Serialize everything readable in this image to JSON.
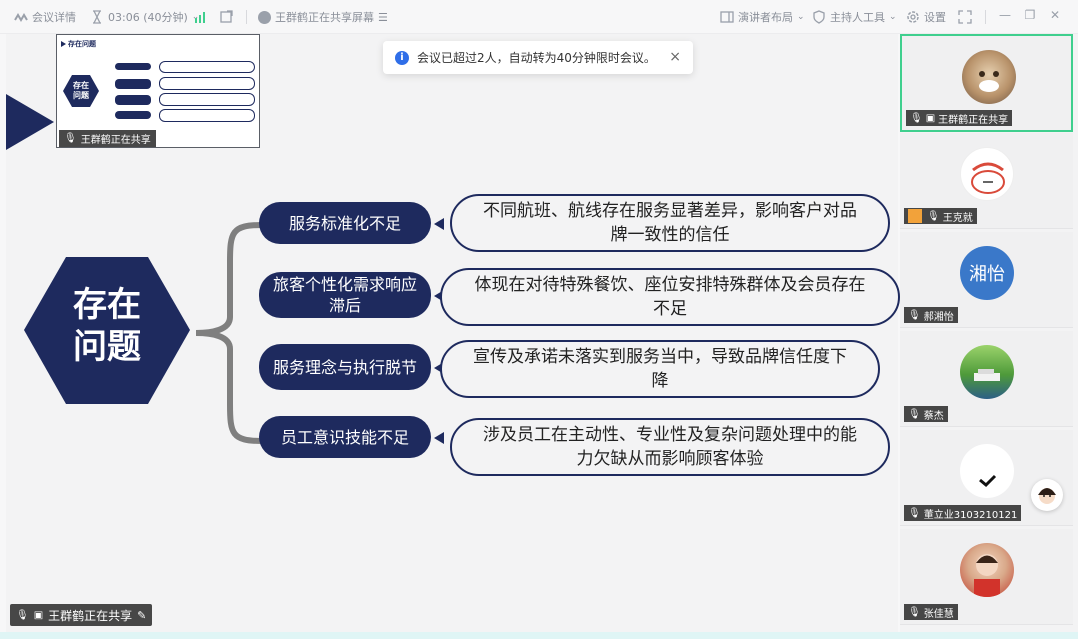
{
  "topbar": {
    "meeting_details": "会议详情",
    "timer": "03:06 (40分钟)",
    "sharing_status": "王群鹤正在共享屏幕",
    "presenter_layout": "演讲者布局",
    "host_tools": "主持人工具",
    "settings": "设置"
  },
  "toast": {
    "message": "会议已超过2人，自动转为40分钟限时会议。",
    "close": "×"
  },
  "thumbnail": {
    "title": "存在问题",
    "center": "存在\n问题",
    "label": "王群鹤正在共享"
  },
  "slide": {
    "center_line1": "存在",
    "center_line2": "问题",
    "categories": [
      {
        "label": "服务标准化不足",
        "description": "不同航班、航线存在服务显著差异，影响客户对品牌一致性的信任"
      },
      {
        "label": "旅客个性化需求响应滞后",
        "description": "体现在对待特殊餐饮、座位安排特殊群体及会员存在不足"
      },
      {
        "label": "服务理念与执行脱节",
        "description": "宣传及承诺未落实到服务当中，导致品牌信任度下降"
      },
      {
        "label": "员工意识技能不足",
        "description": "涉及员工在主动性、专业性及复杂问题处理中的能力欠缺从而影响顾客体验"
      }
    ]
  },
  "sharer_label": "王群鹤正在共享",
  "participants": [
    {
      "name": "王群鹤正在共享"
    },
    {
      "name": "王克就"
    },
    {
      "name": "郝湘怡",
      "initials": "湘怡"
    },
    {
      "name": "蔡杰"
    },
    {
      "name": "董立业3103210121"
    },
    {
      "name": "张佳慧"
    }
  ],
  "colors": {
    "navy": "#1e2a5e",
    "accent_green": "#3fcf8e",
    "info_blue": "#2f6ee8",
    "avatar_blue": "#3a78c9"
  }
}
